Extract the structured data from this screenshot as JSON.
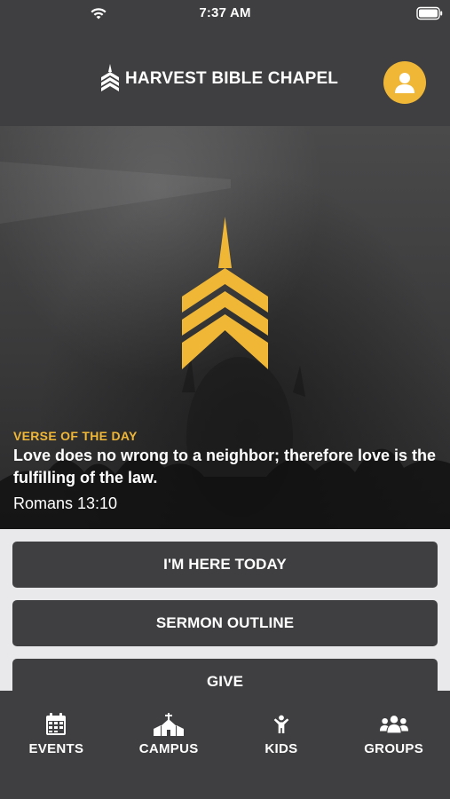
{
  "status_bar": {
    "time": "7:37 AM"
  },
  "header": {
    "brand_name": "HARVEST BIBLE CHAPEL"
  },
  "hero": {
    "verse_label": "VERSE OF THE DAY",
    "verse_text": "Love does no wrong to a neighbor; therefore love is the fulfilling of the law.",
    "verse_reference": "Romans 13:10"
  },
  "actions": [
    {
      "label": "I'M HERE TODAY"
    },
    {
      "label": "SERMON OUTLINE"
    },
    {
      "label": "GIVE"
    }
  ],
  "tabs": [
    {
      "label": "EVENTS",
      "icon": "calendar-icon"
    },
    {
      "label": "CAMPUS",
      "icon": "church-icon"
    },
    {
      "label": "KIDS",
      "icon": "child-icon"
    },
    {
      "label": "GROUPS",
      "icon": "group-icon"
    }
  ],
  "colors": {
    "accent": "#f0b737",
    "bar_background": "#3f3f41",
    "page_background": "#e9e9ec"
  }
}
